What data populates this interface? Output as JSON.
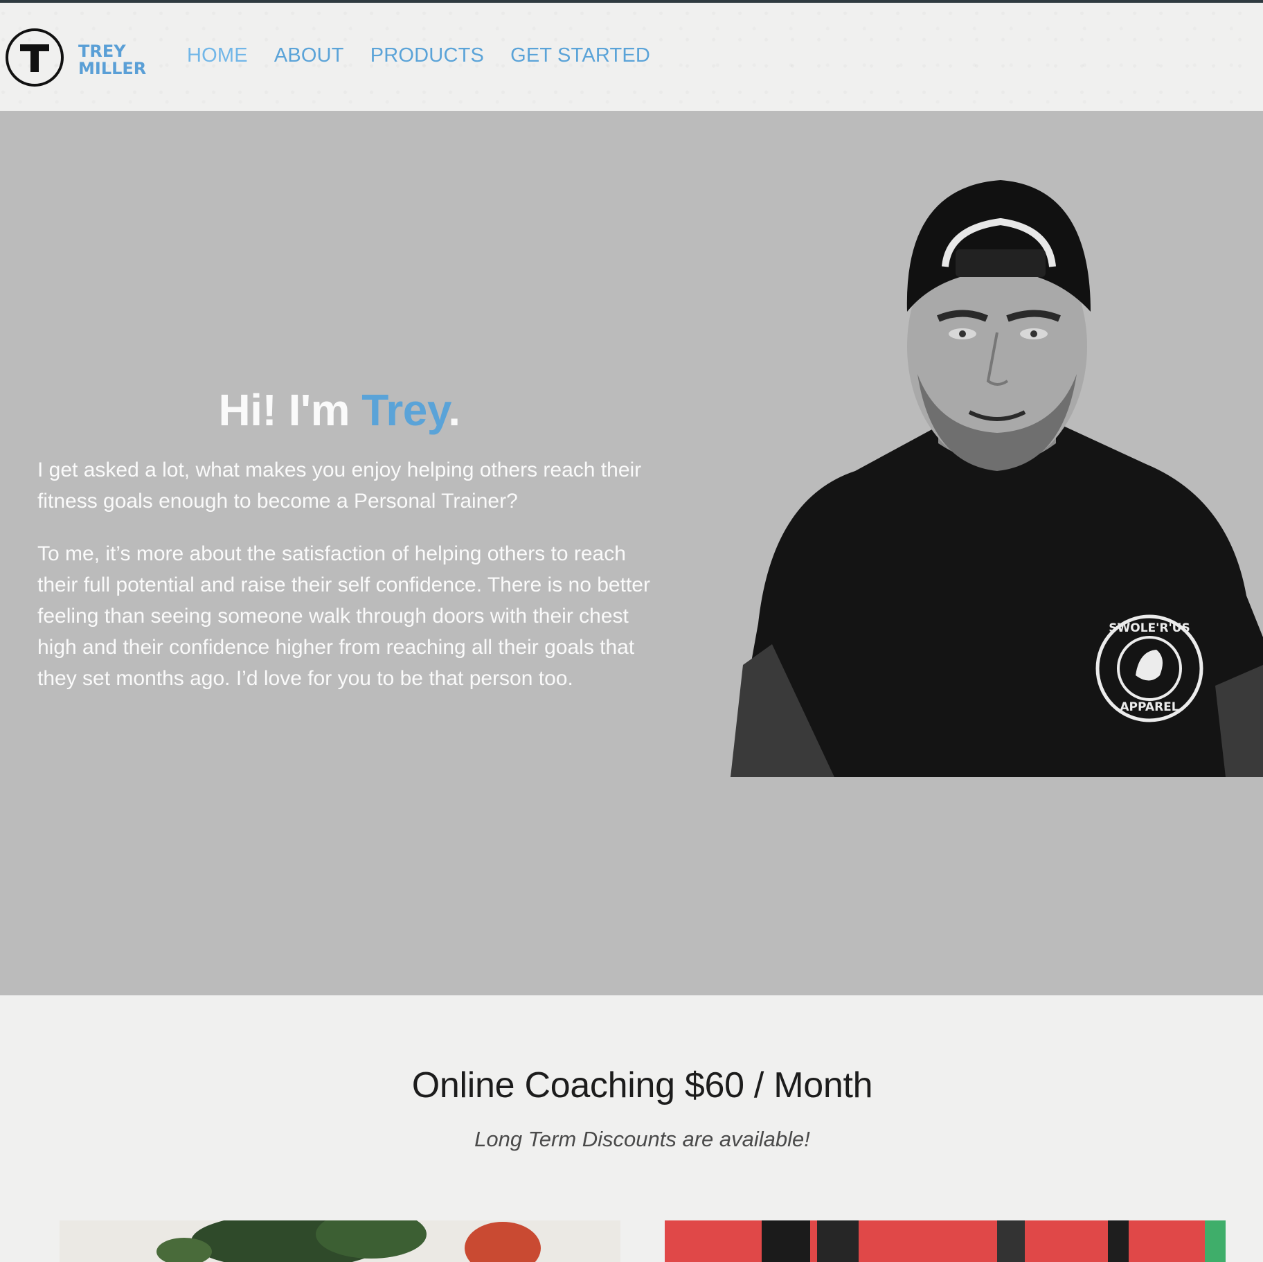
{
  "brand": {
    "logo_letter": "T",
    "name_line1": "TREY",
    "name_line2": "MILLER",
    "accent_color": "#5aa3d8"
  },
  "nav": {
    "items": [
      {
        "label": "HOME"
      },
      {
        "label": "ABOUT"
      },
      {
        "label": "PRODUCTS"
      },
      {
        "label": "GET STARTED"
      }
    ]
  },
  "hero": {
    "title_prefix": "Hi! I'm ",
    "title_name": "Trey",
    "title_suffix": ".",
    "paragraph1": "I get asked a lot, what makes you enjoy helping others reach their fitness goals enough to become a Personal Trainer?",
    "paragraph2": "To me, it’s more about the satisfaction of helping others to reach their full potential and raise their self confidence. There is no better feeling than seeing someone walk through doors with their chest high and their confidence higher from reaching all their goals that they set months ago. I’d love for you to be that person too.",
    "shirt_logo_top": "SWOLE'R'US",
    "shirt_logo_bottom": "APPAREL"
  },
  "pricing": {
    "title": "Online Coaching $60 / Month",
    "subtitle": "Long Term Discounts are available!"
  }
}
